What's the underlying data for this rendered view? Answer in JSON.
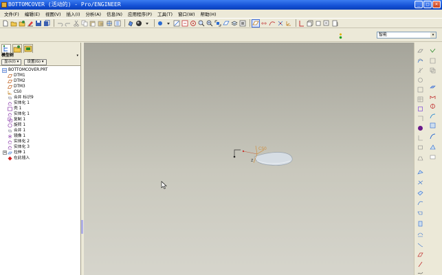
{
  "window": {
    "title": "BOTTOMCOVER (活动的) - Pro/ENGINEER",
    "minimize": "_",
    "maximize": "□",
    "close": "×"
  },
  "menu": [
    "文件(F)",
    "编辑(E)",
    "视图(V)",
    "插入(I)",
    "分析(A)",
    "信息(N)",
    "应用程序(P)",
    "工具(T)",
    "窗口(W)",
    "帮助(H)"
  ],
  "smart_filter": {
    "value": "智能",
    "arrow": "▾"
  },
  "model_tree": {
    "header": "模型树",
    "header_arrow": "▾",
    "buttons": [
      "显示(I) ▾",
      "设置(G) ▾"
    ],
    "items": [
      {
        "label": "BOTTOMCOVER.PRT",
        "icon": "part-icon",
        "level": 0,
        "expand": ""
      },
      {
        "label": "DTM1",
        "icon": "datum-plane-icon",
        "level": 1,
        "expand": ""
      },
      {
        "label": "DTM2",
        "icon": "datum-plane-icon",
        "level": 1,
        "expand": ""
      },
      {
        "label": "DTM3",
        "icon": "datum-plane-icon",
        "level": 1,
        "expand": ""
      },
      {
        "label": "CS0",
        "icon": "csys-icon",
        "level": 1,
        "expand": ""
      },
      {
        "label": "合并 标识9",
        "icon": "merge-icon",
        "level": 1,
        "expand": ""
      },
      {
        "label": "实体化 1",
        "icon": "solidify-icon",
        "level": 1,
        "expand": ""
      },
      {
        "label": "壳 1",
        "icon": "shell-icon",
        "level": 1,
        "expand": ""
      },
      {
        "label": "实体化 1",
        "icon": "solidify-icon",
        "level": 1,
        "expand": ""
      },
      {
        "label": "复制 1",
        "icon": "copy-icon",
        "level": 1,
        "expand": ""
      },
      {
        "label": "旋转 1",
        "icon": "revolve-icon",
        "level": 1,
        "expand": ""
      },
      {
        "label": "合并 1",
        "icon": "merge-icon",
        "level": 1,
        "expand": ""
      },
      {
        "label": "镜像 1",
        "icon": "mirror-icon",
        "level": 1,
        "expand": ""
      },
      {
        "label": "实体化 2",
        "icon": "solidify-icon",
        "level": 1,
        "expand": ""
      },
      {
        "label": "实体化 3",
        "icon": "solidify-icon",
        "level": 1,
        "expand": ""
      },
      {
        "label": "拉伸 1",
        "icon": "extrude-icon",
        "level": 1,
        "expand": "+"
      },
      {
        "label": "在此插入",
        "icon": "insert-here-icon",
        "level": 1,
        "expand": ""
      }
    ]
  },
  "viewport": {
    "csys_label": "CS0",
    "axis_label": "Z"
  },
  "colors": {
    "title_bar": "#1451d6",
    "datum_curve": "#c06040",
    "csys": "#d09040",
    "part_fill": "#d4dbe3"
  }
}
